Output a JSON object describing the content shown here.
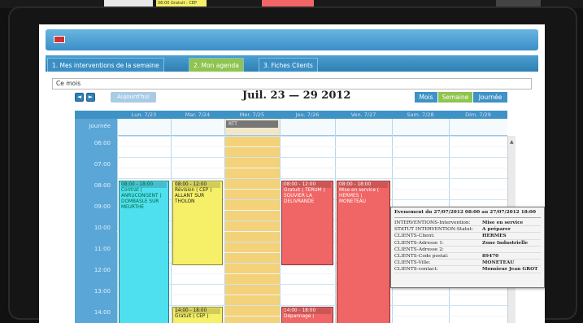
{
  "colors": {
    "accent": "#3f92c6",
    "active_tab": "#8fc44f",
    "event_yellow": "#f5f067",
    "event_cyan": "#4fe0f0",
    "event_red": "#f06565",
    "today_col": "#f3d27a"
  },
  "top_strip": {
    "snippet1": "08:00 Gratuit : CEP"
  },
  "window": {
    "icon": "app-icon"
  },
  "tabs": [
    {
      "label": "1. Mes interventions de la semaine"
    },
    {
      "label": "2. Mon agenda"
    },
    {
      "label": "3. Fiches Clients"
    }
  ],
  "filter_field": {
    "value": "Ce mois"
  },
  "toolbar": {
    "prev": "◄",
    "next": "►",
    "today": "Aujourd'hui",
    "period": "Juil. 23 — 29 2012",
    "views": [
      "Mois",
      "Semaine",
      "Journée"
    ]
  },
  "days": [
    "Lun. 7/23",
    "Mar. 7/24",
    "Mer. 7/25",
    "Jeu. 7/26",
    "Ven. 7/27",
    "Sam. 7/28",
    "Dim. 7/29"
  ],
  "allday_label": "Journée",
  "times": [
    "06:00",
    "07:00",
    "08:00",
    "09:00",
    "10:00",
    "11:00",
    "12:00",
    "13:00",
    "14:00"
  ],
  "allday_event": "RTT",
  "events": [
    {
      "time": "08:00 - 18:00",
      "text": "Contrat ( ANRUCONGENT ) DOMBASLE SUR MEURTHE"
    },
    {
      "time": "08:00 - 12:00",
      "text": "Révision ( CEP ) ALLANT SUR THOLON"
    },
    {
      "time": "08:00 - 12:00",
      "text": "Gratuit ( TERUM ) SOUVIER LA DELIVRANDE"
    },
    {
      "time": "08:00 - 18:00",
      "text": "Mise en service ( HERMES ) MONETEAU"
    },
    {
      "time": "14:00 - 18:00",
      "text": "Gratuit ( CEP )"
    },
    {
      "time": "14:00 - 18:00",
      "text": "Dépannage ("
    }
  ],
  "tooltip": {
    "header": "Evenement du 27/07/2012 08:00 au 27/07/2012 18:00",
    "rows": [
      {
        "k": "INTERVENTIONS-Intervention:",
        "v": "Mise en service"
      },
      {
        "k": "STATUT INTERVENTION-Statut:",
        "v": "A préparer"
      },
      {
        "k": "CLIENTS-Client:",
        "v": "HERMES"
      },
      {
        "k": "CLIENTS-Adresse 1:",
        "v": "Zone Industrielle"
      },
      {
        "k": "CLIENTS-Adresse 2:",
        "v": ""
      },
      {
        "k": "CLIENTS-Code postal:",
        "v": "89470"
      },
      {
        "k": "CLIENTS-Ville:",
        "v": "MONETEAU"
      },
      {
        "k": "CLIENTS-contact:",
        "v": "Monsieur Jean GROT"
      }
    ]
  }
}
